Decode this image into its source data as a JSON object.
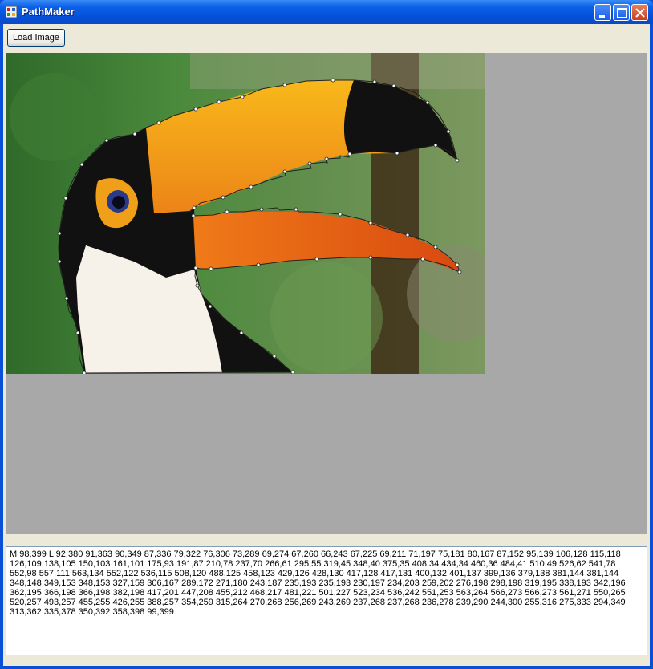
{
  "window": {
    "title": "PathMaker"
  },
  "toolbar": {
    "load_image_label": "Load Image"
  },
  "icons": {
    "app": "app-icon",
    "minimize": "minimize-icon",
    "maximize": "maximize-icon",
    "close": "close-icon"
  },
  "canvas": {
    "background": "#a8a8a8"
  },
  "path_output": {
    "text": "M 98,399 L 92,380 91,363 90,349 87,336 79,322 76,306 73,289 69,274 67,260 66,243 67,225 69,211 71,197 75,181 80,167 87,152 95,139 106,128 115,118 126,109 138,105 150,103 161,101 175,93 191,87 210,78 237,70 266,61 295,55 319,45 348,40 375,35 408,34 434,34 460,36 484,41 510,49 526,62 541,78 552,98 557,111 563,134 552,122 536,115 508,120 488,125 458,123 429,126 428,130 417,128 417,131 400,132 401,137 399,136 379,138 381,144 381,144 348,148 349,153 348,153 327,159 306,167 289,172 271,180 243,187 235,193 235,193 230,197 234,203 259,202 276,198 298,198 319,195 338,193 342,196 362,195 366,198 366,198 382,198 417,201 447,208 455,212 468,217 481,221 501,227 523,234 536,242 551,253 563,264 566,273 566,273 561,271 550,265 520,257 493,257 455,255 426,255 388,257 354,259 315,264 270,268 256,269 243,269 237,268 237,268 236,278 239,290 244,300 255,316 275,333 294,349 313,362 335,378 350,392 358,398 99,399"
  }
}
